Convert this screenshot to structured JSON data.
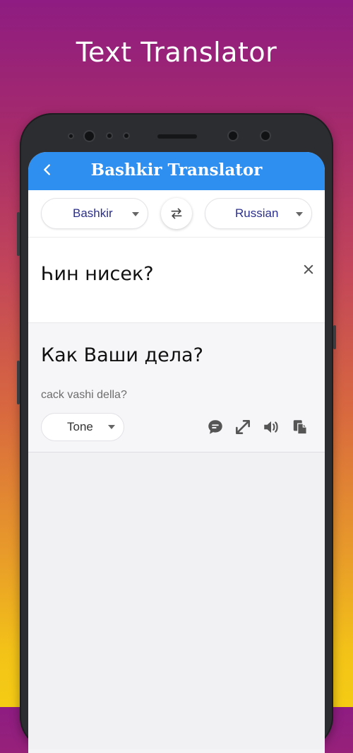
{
  "headline": "Text Translator",
  "app": {
    "title": "Bashkir Translator",
    "source_language": "Bashkir",
    "target_language": "Russian",
    "input_text": "Һин нисек?",
    "output_text": "Как Ваши дела?",
    "transliteration": "cack vashi della?",
    "tone_label": "Tone"
  },
  "icons": {
    "back": "chevron-left",
    "swap": "swap-arrows",
    "clear": "close-x",
    "chat": "chat-bubble",
    "expand": "expand-arrows",
    "speak": "speaker-volume",
    "copy": "copy-documents"
  },
  "colors": {
    "appbar": "#2e8ff0",
    "language_text": "#2b2f8c"
  }
}
